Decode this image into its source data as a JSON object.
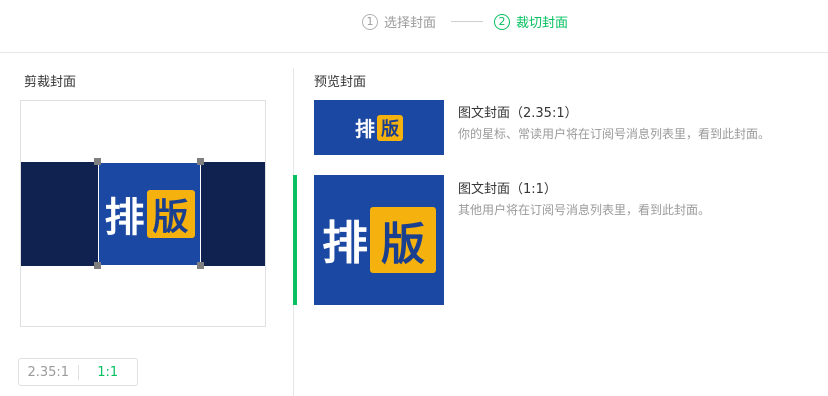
{
  "steps": {
    "step1": {
      "num": "1",
      "label": "选择封面"
    },
    "step2": {
      "num": "2",
      "label": "裁切封面"
    }
  },
  "crop": {
    "title": "剪裁封面",
    "cover_text_left": "排",
    "cover_text_right": "版"
  },
  "ratio": {
    "option1": "2.35:1",
    "option2": "1:1",
    "selected": "1:1"
  },
  "preview": {
    "title": "预览封面",
    "wide": {
      "title": "图文封面（2.35:1）",
      "desc": "你的星标、常读用户将在订阅号消息列表里，看到此封面。",
      "text_left": "排",
      "text_right": "版"
    },
    "square": {
      "title": "图文封面（1:1）",
      "desc": "其他用户将在订阅号消息列表里，看到此封面。",
      "text_left": "排",
      "text_right": "版"
    }
  },
  "colors": {
    "accent": "#07c160",
    "cover_blue": "#1b48a2",
    "cover_dark": "#102350",
    "badge_yellow": "#f5b20f"
  }
}
